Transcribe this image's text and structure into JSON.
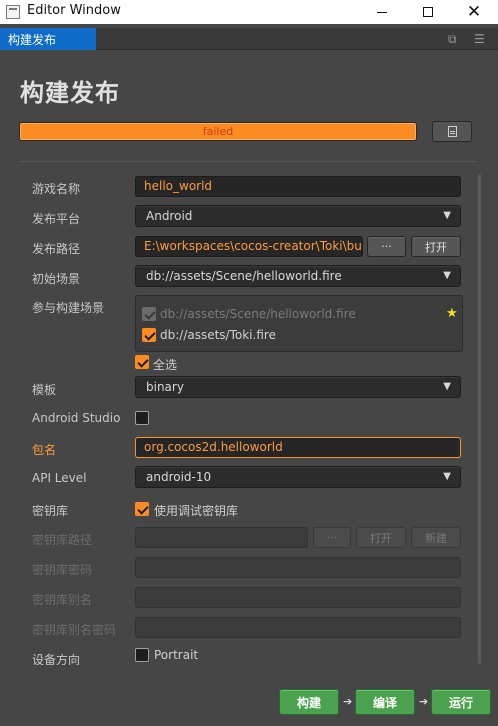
{
  "window": {
    "title": "Editor Window",
    "minimize_icon": "minimize-icon",
    "maximize_icon": "maximize-icon",
    "close_glyph": "✕"
  },
  "tab": {
    "label": "构建发布",
    "popout_icon": "popout-icon",
    "menu_icon": "hamburger-menu-icon",
    "popout_glyph": "⧉",
    "menu_glyph": "☰"
  },
  "heading": "构建发布",
  "progress": {
    "value": 1.0,
    "status": "failed",
    "log_icon": "document-icon"
  },
  "form": {
    "game_name": {
      "label": "游戏名称",
      "value": "hello_world"
    },
    "platform": {
      "label": "发布平台",
      "value": "Android"
    },
    "build_path": {
      "label": "发布路径",
      "value": "E:\\workspaces\\cocos-creator\\Toki\\build",
      "browse": "···",
      "open": "打开"
    },
    "start_scene": {
      "label": "初始场景",
      "value": "db://assets/Scene/helloworld.fire"
    },
    "included_scenes": {
      "label": "参与构建场景",
      "items": [
        {
          "path": "db://assets/Scene/helloworld.fire",
          "checked": true,
          "disabled": true
        },
        {
          "path": "db://assets/Toki.fire",
          "checked": true,
          "disabled": false
        }
      ],
      "select_all": "全选"
    },
    "template": {
      "label": "模板",
      "value": "binary"
    },
    "android_studio": {
      "label": "Android Studio",
      "checked": false
    },
    "package_name": {
      "label": "包名",
      "value": "org.cocos2d.helloworld"
    },
    "api_level": {
      "label": "API Level",
      "value": "android-10"
    },
    "keystore": {
      "label": "密钥库",
      "use_debug": "使用调试密钥库",
      "checked": true
    },
    "keystore_path": {
      "label": "密钥库路径",
      "browse": "···",
      "open": "打开",
      "new": "新建"
    },
    "keystore_password": {
      "label": "密钥库密码"
    },
    "keystore_alias": {
      "label": "密钥库别名"
    },
    "keystore_alias_password": {
      "label": "密钥库别名密码"
    },
    "orientation": {
      "label": "设备方向",
      "portrait": "Portrait"
    }
  },
  "actions": {
    "build": "构建",
    "compile": "编译",
    "run": "运行"
  },
  "colors": {
    "accent": "#fb8c21",
    "progress_text": "#d23a1b",
    "action_green": "#4aa24f",
    "tab_blue": "#0f6bc8"
  }
}
